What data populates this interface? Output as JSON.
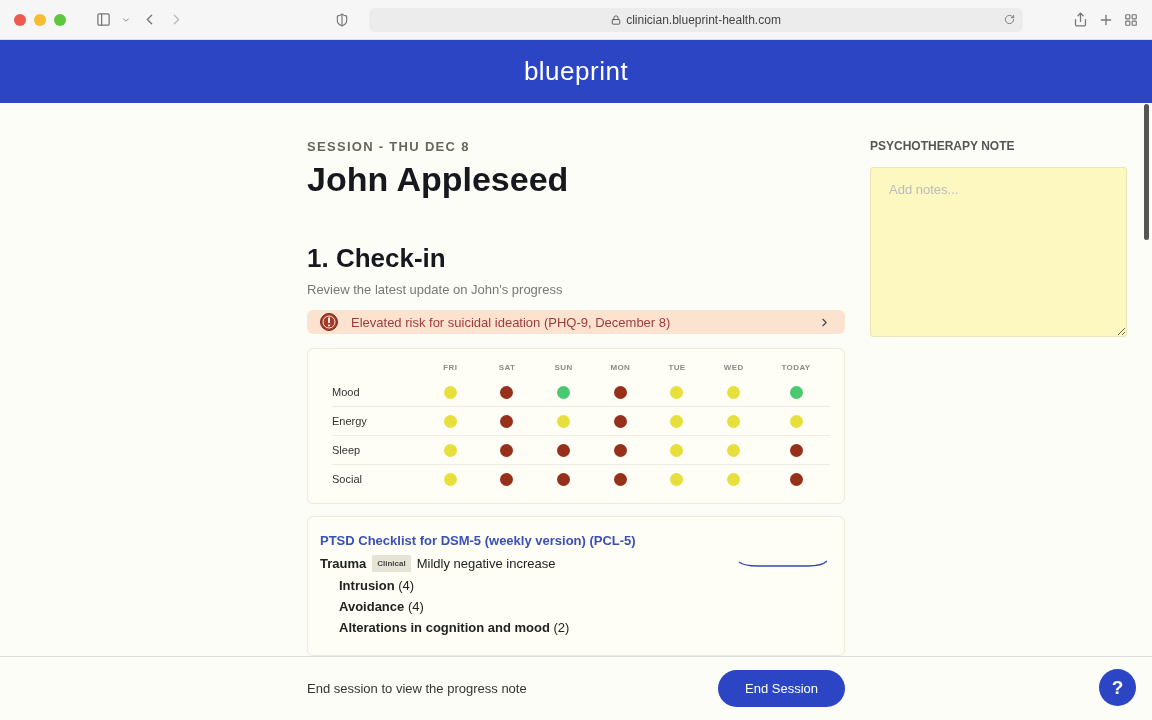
{
  "browser": {
    "url": "clinician.blueprint-health.com"
  },
  "header": {
    "logo": "blueprint"
  },
  "session": {
    "eyebrow": "SESSION - THU DEC 8",
    "patient_name": "John Appleseed"
  },
  "section": {
    "title": "1. Check-in",
    "subtitle": "Review the latest update on John's progress"
  },
  "alert": {
    "text": "Elevated risk for suicidal ideation (PHQ-9, December 8)"
  },
  "tracker": {
    "days": [
      "FRI",
      "SAT",
      "SUN",
      "MON",
      "TUE",
      "WED",
      "TODAY"
    ],
    "rows": [
      {
        "label": "Mood",
        "dots": [
          {
            "color": "#e6df3c"
          },
          {
            "color": "#97301a"
          },
          {
            "color": "#4cc873"
          },
          {
            "color": "#97301a"
          },
          {
            "color": "#e6df3c"
          },
          {
            "color": "#e6df3c"
          },
          {
            "color": "#4cc873"
          }
        ]
      },
      {
        "label": "Energy",
        "dots": [
          {
            "color": "#e6df3c"
          },
          {
            "color": "#97301a"
          },
          {
            "color": "#e6df3c"
          },
          {
            "color": "#97301a"
          },
          {
            "color": "#e6df3c"
          },
          {
            "color": "#e6df3c"
          },
          {
            "color": "#e6df3c"
          }
        ]
      },
      {
        "label": "Sleep",
        "dots": [
          {
            "color": "#e6df3c"
          },
          {
            "color": "#97301a"
          },
          {
            "color": "#97301a"
          },
          {
            "color": "#97301a"
          },
          {
            "color": "#e6df3c"
          },
          {
            "color": "#e6df3c"
          },
          {
            "color": "#97301a"
          }
        ]
      },
      {
        "label": "Social",
        "dots": [
          {
            "color": "#e6df3c"
          },
          {
            "color": "#97301a"
          },
          {
            "color": "#97301a"
          },
          {
            "color": "#97301a"
          },
          {
            "color": "#e6df3c"
          },
          {
            "color": "#e6df3c"
          },
          {
            "color": "#97301a"
          }
        ]
      }
    ]
  },
  "checklist": {
    "title": "PTSD Checklist for DSM-5 (weekly version) (PCL-5)",
    "category": {
      "name": "Trauma",
      "badge": "Clinical",
      "trend": "Mildly negative increase"
    },
    "items": [
      {
        "name": "Intrusion",
        "score": "(4)"
      },
      {
        "name": "Avoidance",
        "score": "(4)"
      },
      {
        "name": "Alterations in cognition and mood",
        "score": "(2)"
      }
    ]
  },
  "note": {
    "heading": "PSYCHOTHERAPY NOTE",
    "placeholder": "Add notes..."
  },
  "footer": {
    "message": "End session to view the progress note",
    "button": "End Session"
  },
  "help_button": {
    "label": "?"
  }
}
